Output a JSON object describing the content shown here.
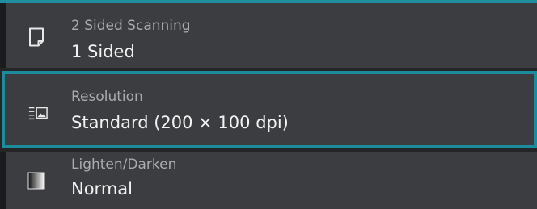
{
  "accent_color": "#1a8c9c",
  "items": [
    {
      "label": "2 Sided Scanning",
      "value": "1 Sided",
      "icon": "page-icon"
    },
    {
      "label": "Resolution",
      "value": "Standard (200 × 100 dpi)",
      "icon": "resolution-icon"
    },
    {
      "label": "Lighten/Darken",
      "value": "Normal",
      "icon": "gradient-icon"
    }
  ]
}
